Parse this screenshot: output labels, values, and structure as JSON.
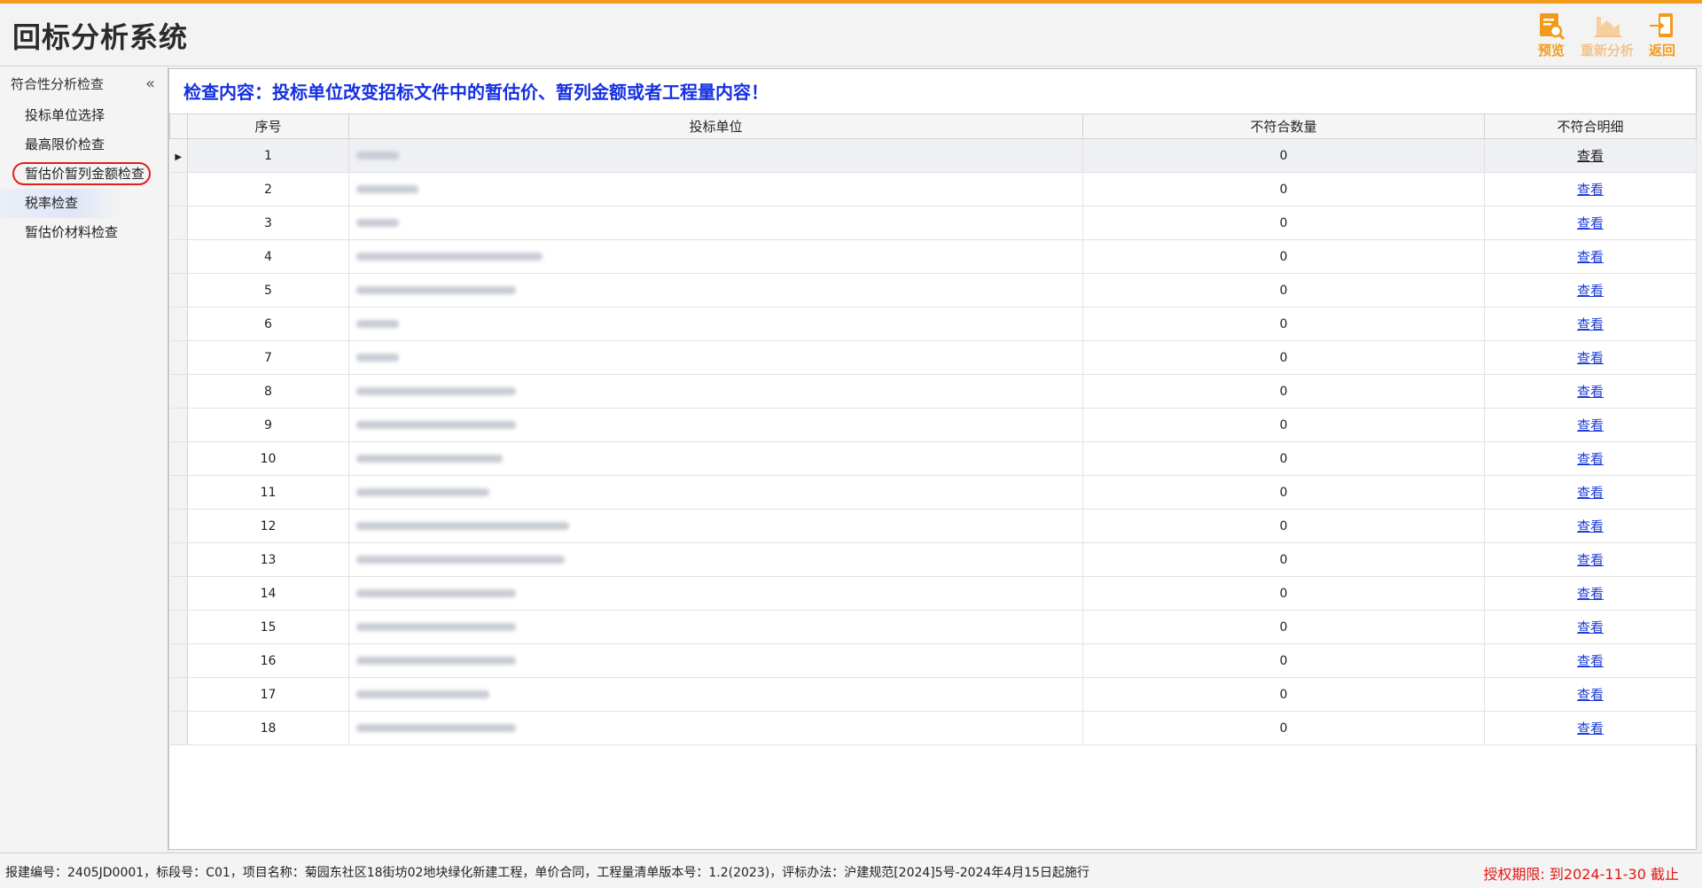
{
  "app": {
    "title": "回标分析系统"
  },
  "toolbar": {
    "preview_label": "预览",
    "reanalyze_label": "重新分析",
    "back_label": "返回",
    "accent_color": "#f39a1c",
    "disabled_color": "#f2c48c"
  },
  "sidebar": {
    "header": "符合性分析检查",
    "collapse_glyph": "«",
    "items": [
      {
        "label": "投标单位选择"
      },
      {
        "label": "最高限价检查"
      },
      {
        "label": "暂估价暂列金额检查"
      },
      {
        "label": "税率检查"
      },
      {
        "label": "暂估价材料检查"
      }
    ]
  },
  "main": {
    "check_title": "检查内容：投标单位改变招标文件中的暂估价、暂列金额或者工程量内容！",
    "columns": [
      "序号",
      "投标单位",
      "不符合数量",
      "不符合明细"
    ],
    "rows": [
      {
        "no": "1",
        "count": "0",
        "detail": "查看"
      },
      {
        "no": "2",
        "count": "0",
        "detail": "查看"
      },
      {
        "no": "3",
        "count": "0",
        "detail": "查看"
      },
      {
        "no": "4",
        "count": "0",
        "detail": "查看"
      },
      {
        "no": "5",
        "count": "0",
        "detail": "查看"
      },
      {
        "no": "6",
        "count": "0",
        "detail": "查看"
      },
      {
        "no": "7",
        "count": "0",
        "detail": "查看"
      },
      {
        "no": "8",
        "count": "0",
        "detail": "查看"
      },
      {
        "no": "9",
        "count": "0",
        "detail": "查看"
      },
      {
        "no": "10",
        "count": "0",
        "detail": "查看"
      },
      {
        "no": "11",
        "count": "0",
        "detail": "查看"
      },
      {
        "no": "12",
        "count": "0",
        "detail": "查看"
      },
      {
        "no": "13",
        "count": "0",
        "detail": "查看"
      },
      {
        "no": "14",
        "count": "0",
        "detail": "查看"
      },
      {
        "no": "15",
        "count": "0",
        "detail": "查看"
      },
      {
        "no": "16",
        "count": "0",
        "detail": "查看"
      },
      {
        "no": "17",
        "count": "0",
        "detail": "查看"
      },
      {
        "no": "18",
        "count": "0",
        "detail": "查看"
      }
    ]
  },
  "status": {
    "info": "报建编号：2405JD0001，标段号：C01，项目名称：菊园东社区18街坊02地块绿化新建工程，单价合同，工程量清单版本号：1.2(2023)，评标办法：沪建规范[2024]5号-2024年4月15日起施行",
    "license": "授权期限: 到2024-11-30 截止",
    "license_color": "#e01818"
  }
}
